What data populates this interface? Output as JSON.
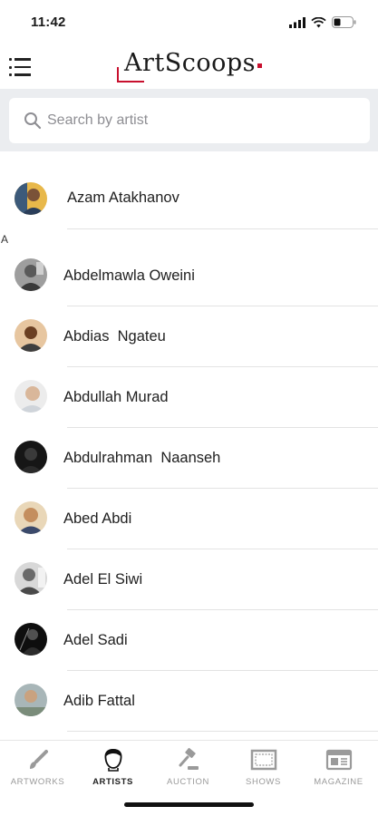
{
  "status_bar": {
    "time": "11:42"
  },
  "header": {
    "logo_text": "ArtScoops",
    "brand_color": "#c8102e"
  },
  "search": {
    "placeholder": "Search by artist",
    "value": ""
  },
  "list": {
    "featured": {
      "name": "Azam Atakhanov",
      "avatar_bg": "#3c5a7a"
    },
    "section_letter": "A",
    "artists": [
      {
        "name": "Abdelmawla Oweini",
        "avatar_bg": "#8a8a8a"
      },
      {
        "name": "Abdias  Ngateu",
        "avatar_bg": "#8a5a3a"
      },
      {
        "name": "Abdullah Murad",
        "avatar_bg": "#d9c2a8"
      },
      {
        "name": "Abdulrahman  Naanseh",
        "avatar_bg": "#1c1c1c"
      },
      {
        "name": "Abed Abdi",
        "avatar_bg": "#c89a6a"
      },
      {
        "name": "Adel El Siwi",
        "avatar_bg": "#bdbdbd"
      },
      {
        "name": "Adel Sadi",
        "avatar_bg": "#121212"
      },
      {
        "name": "Adib Fattal",
        "avatar_bg": "#6d7f86"
      }
    ]
  },
  "tabbar": {
    "tabs": [
      {
        "label": "ARTWORKS",
        "icon": "brush-icon",
        "active": false
      },
      {
        "label": "ARTISTS",
        "icon": "artist-head-icon",
        "active": true
      },
      {
        "label": "AUCTION",
        "icon": "gavel-icon",
        "active": false
      },
      {
        "label": "SHOWS",
        "icon": "frame-icon",
        "active": false
      },
      {
        "label": "MAGAZINE",
        "icon": "magazine-icon",
        "active": false
      }
    ]
  }
}
